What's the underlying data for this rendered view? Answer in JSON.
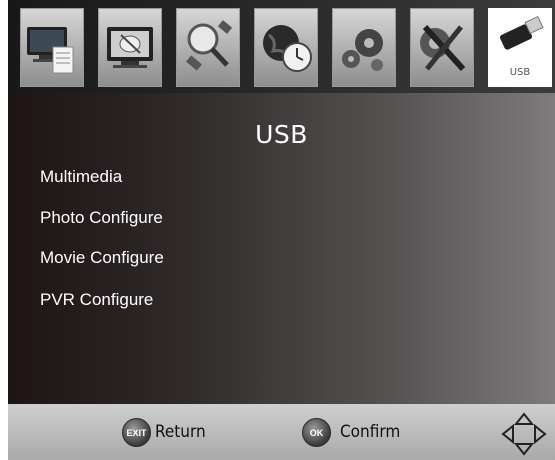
{
  "tabs": [
    {
      "icon": "tv-document-icon"
    },
    {
      "icon": "tv-satellite-dish-icon"
    },
    {
      "icon": "satellite-search-icon"
    },
    {
      "icon": "globe-clock-icon"
    },
    {
      "icon": "gears-icon"
    },
    {
      "icon": "tools-icon"
    },
    {
      "icon": "usb-drive-icon",
      "label": "USB",
      "active": true
    }
  ],
  "page": {
    "title": "USB"
  },
  "menu": {
    "items": [
      "Multimedia",
      "Photo Configure",
      "Movie Configure",
      "PVR Configure"
    ]
  },
  "footer": {
    "exit_badge": "EXIT",
    "return_label": "Return",
    "ok_badge": "OK",
    "confirm_label": "Confirm",
    "nav_icon": "navigation-pad-icon"
  },
  "colors": {
    "background_dark": "#1e1414",
    "background_light": "#7d7b7b",
    "footer": "#bdbdbd",
    "text": "#ffffff"
  }
}
